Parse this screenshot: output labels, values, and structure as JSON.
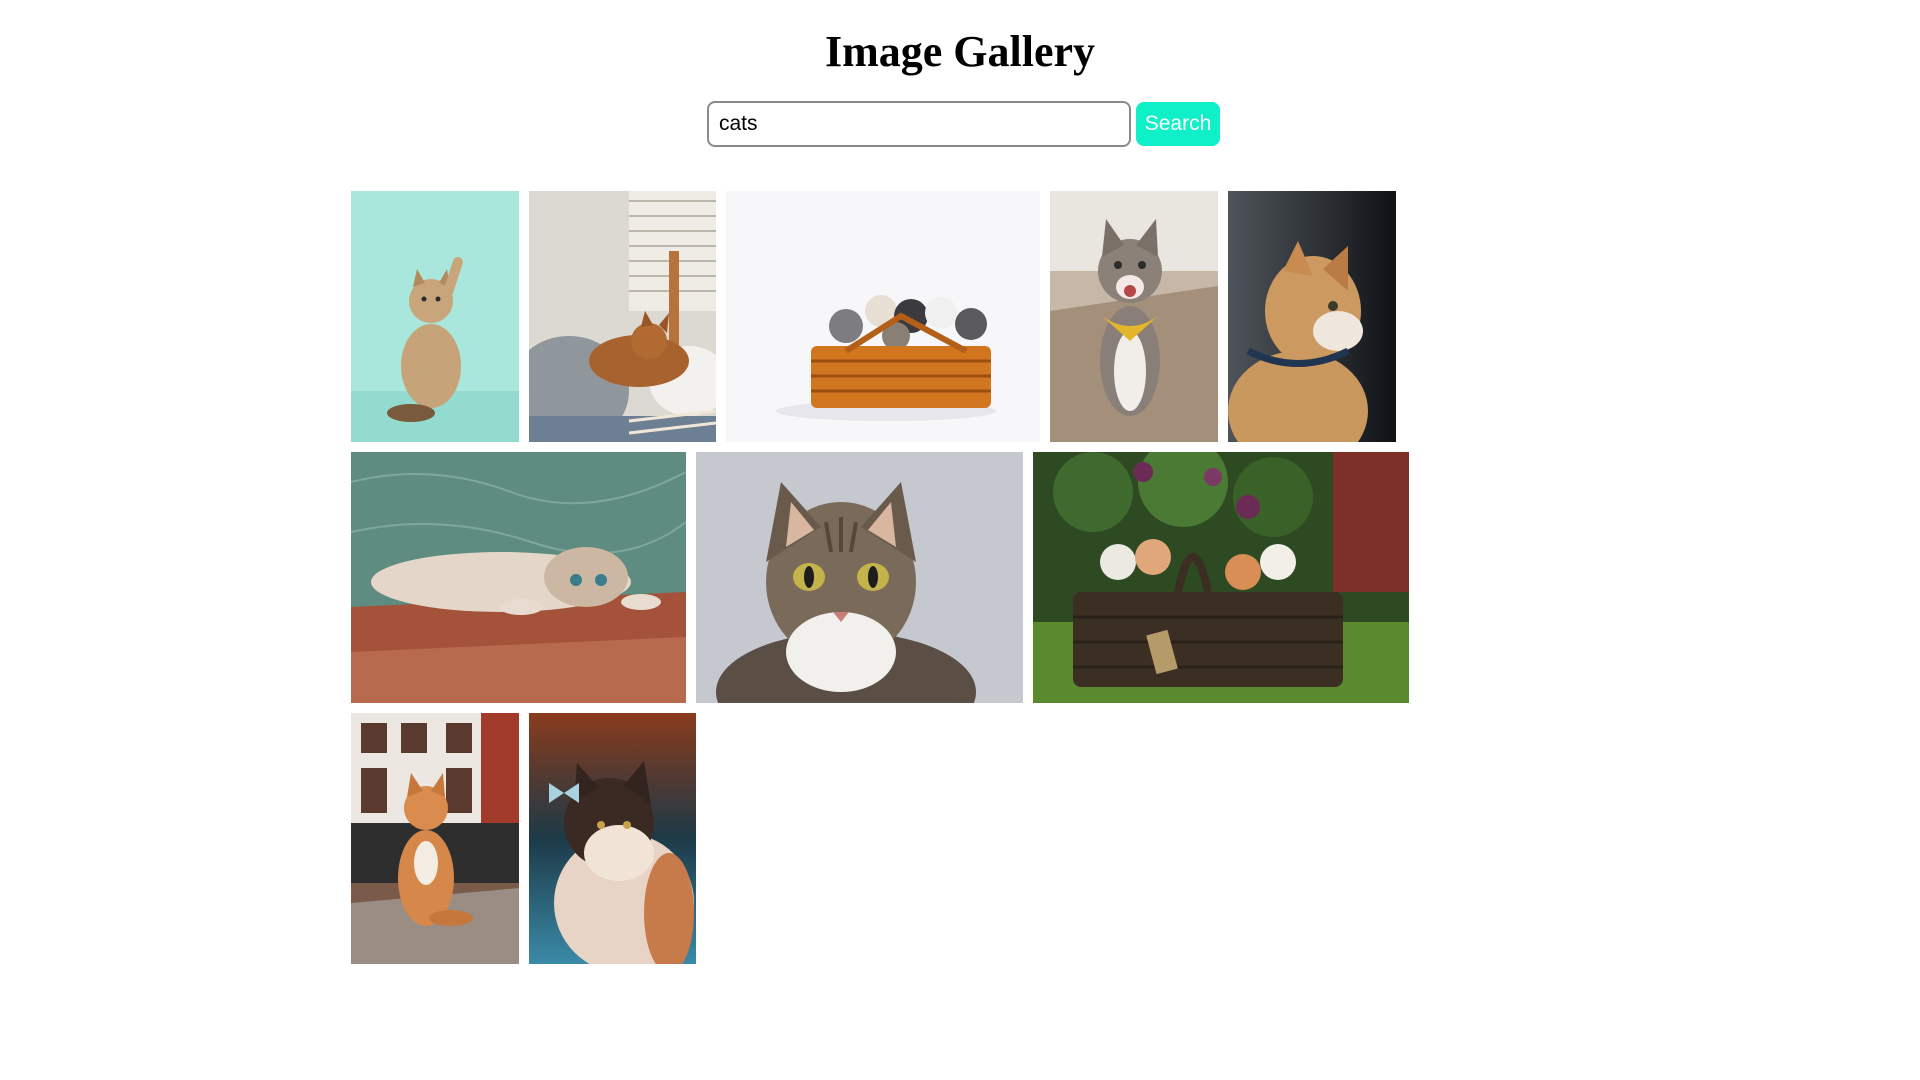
{
  "page": {
    "title": "Image Gallery"
  },
  "search": {
    "value": "cats",
    "button_label": "Search",
    "button_color": "#0ff0c8"
  },
  "gallery": {
    "rows": [
      [
        {
          "name": "cat-raising-paw-teal-background",
          "bg": "#a8e6dc"
        },
        {
          "name": "orange-cat-sleeping-on-blanket",
          "bg": "#d9d6d0"
        },
        {
          "name": "kittens-in-wicker-basket",
          "bg": "#f4f4f6"
        },
        {
          "name": "cat-with-yellow-bandana",
          "bg": "#bfb3a6"
        },
        {
          "name": "orange-cat-profile-collar",
          "bg": "#3a3f44"
        }
      ],
      [
        {
          "name": "cat-lying-upside-down-on-floor",
          "bg": "#5f8e84"
        },
        {
          "name": "tabby-cat-portrait",
          "bg": "#c9ccd2"
        },
        {
          "name": "kittens-in-basket-on-grass",
          "bg": "#3d5c2c"
        }
      ],
      [
        {
          "name": "orange-cat-sitting-on-street",
          "bg": "#8a6b55"
        },
        {
          "name": "fluffy-cat-with-butterfly",
          "bg": "#2a4a58"
        }
      ]
    ]
  }
}
